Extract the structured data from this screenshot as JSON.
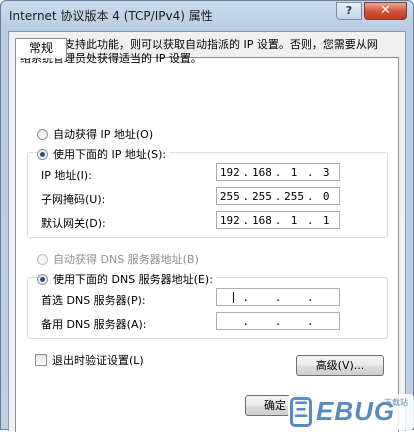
{
  "window": {
    "title": "Internet 协议版本 4 (TCP/IPv4) 属性",
    "help_label": "?",
    "close_label": "✕"
  },
  "tabs": [
    {
      "label": "常规"
    }
  ],
  "description": "如果网络支持此功能，则可以获取自动指派的 IP 设置。否则，您需要从网络系统管理员处获得适当的 IP 设置。",
  "ip_section": {
    "auto_label": "自动获得 IP 地址(O)",
    "manual_label": "使用下面的 IP 地址(S):",
    "selected": "manual",
    "fields": [
      {
        "label": "IP 地址(I):",
        "octets": [
          "192",
          "168",
          "1",
          "3"
        ]
      },
      {
        "label": "子网掩码(U):",
        "octets": [
          "255",
          "255",
          "255",
          "0"
        ]
      },
      {
        "label": "默认网关(D):",
        "octets": [
          "192",
          "168",
          "1",
          "1"
        ]
      }
    ]
  },
  "dns_section": {
    "auto_label": "自动获得 DNS 服务器地址(B)",
    "manual_label": "使用下面的 DNS 服务器地址(E):",
    "selected": "manual",
    "fields": [
      {
        "label": "首选 DNS 服务器(P):",
        "octets": [
          "",
          "",
          "",
          ""
        ]
      },
      {
        "label": "备用 DNS 服务器(A):",
        "octets": [
          "",
          "",
          "",
          ""
        ]
      }
    ]
  },
  "validate_on_exit_label": "退出时验证设置(L)",
  "validate_on_exit_checked": false,
  "advanced_button": "高级(V)...",
  "ok_button": "确定",
  "watermark": {
    "text": "EBUG",
    "small": "下载站",
    "symbol": "Ξ"
  },
  "colors": {
    "accent": "#2a4e8a",
    "window_frame": "#b9cde3",
    "close": "#c23a20"
  }
}
